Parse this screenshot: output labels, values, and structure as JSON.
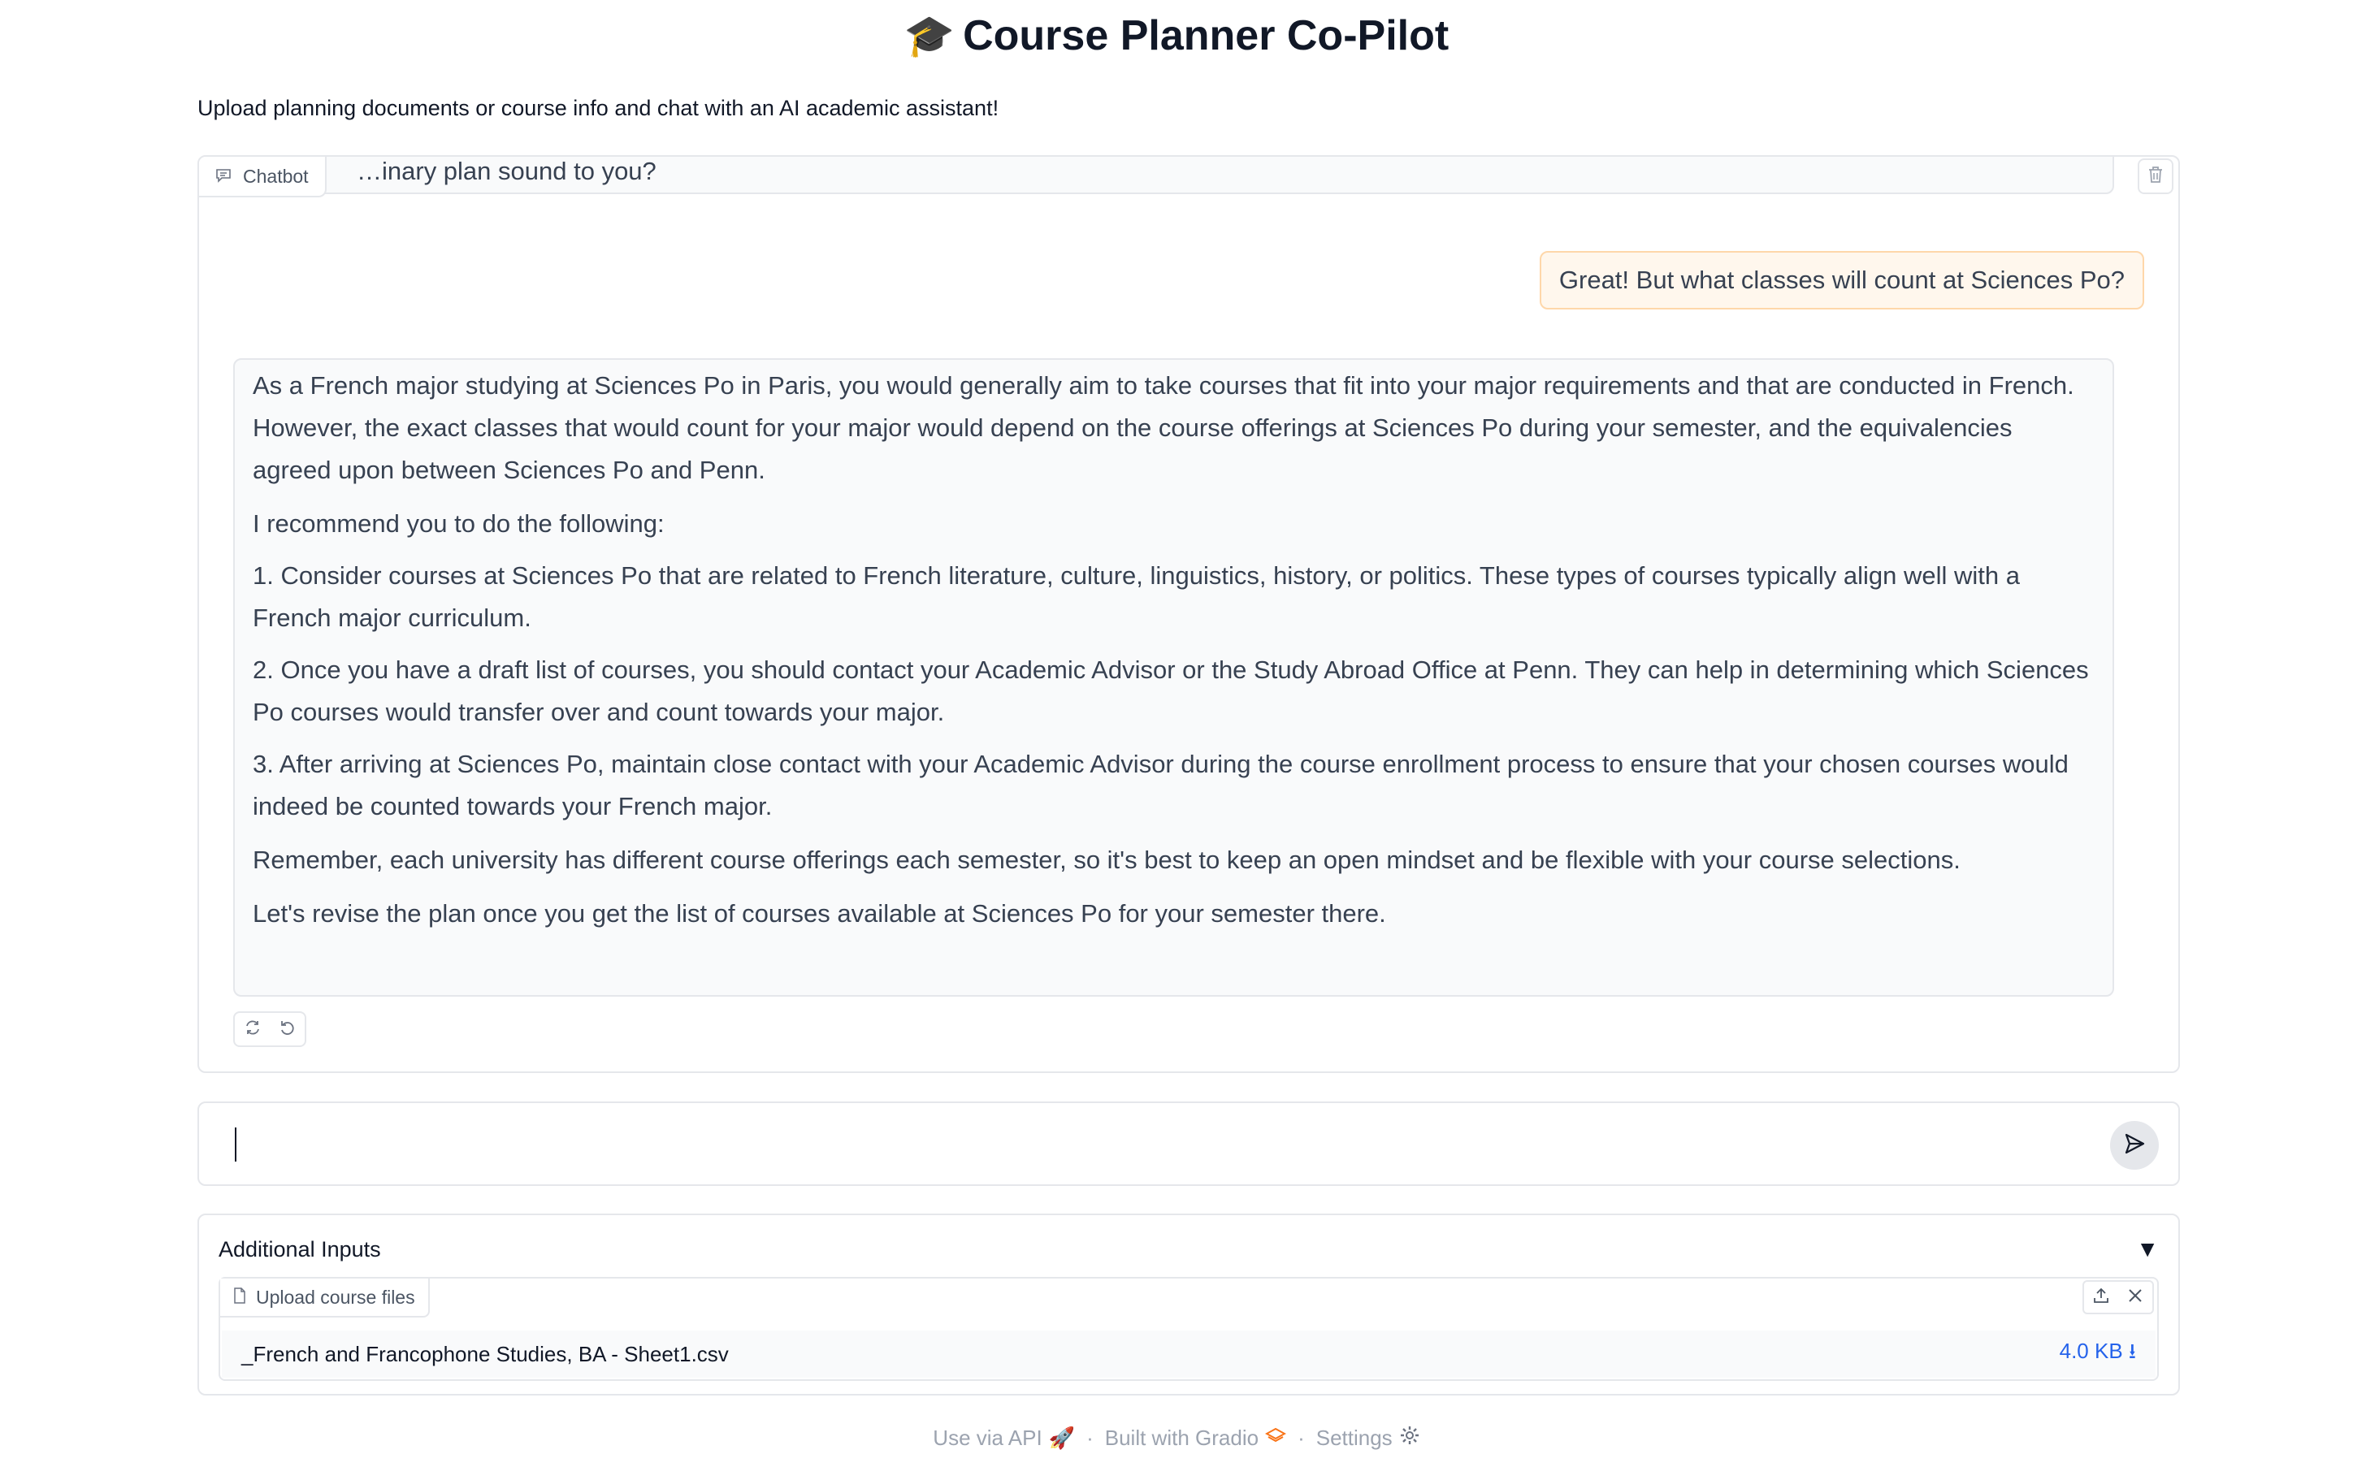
{
  "header": {
    "icon": "graduation-cap",
    "title": "Course Planner Co-Pilot",
    "subtitle": "Upload planning documents or course info and chat with an AI academic assistant!"
  },
  "chatbot": {
    "label": "Chatbot",
    "partial_message": "…inary plan sound to you?",
    "user_message": "Great! But what classes will count at Sciences Po?",
    "bot_message": {
      "p1": "As a French major studying at Sciences Po in Paris, you would generally aim to take courses that fit into your major requirements and that are conducted in French. However, the exact classes that would count for your major would depend on the course offerings at Sciences Po during your semester, and the equivalencies agreed upon between Sciences Po and Penn.",
      "p2": "I recommend you to do the following:",
      "p3": "1. Consider courses at Sciences Po that are related to French literature, culture, linguistics, history, or politics. These types of courses typically align well with a French major curriculum.",
      "p4": "2. Once you have a draft list of courses, you should contact your Academic Advisor or the Study Abroad Office at Penn. They can help in determining which Sciences Po courses would transfer over and count towards your major.",
      "p5": "3. After arriving at Sciences Po, maintain close contact with your Academic Advisor during the course enrollment process to ensure that your chosen courses would indeed be counted towards your French major.",
      "p6": "Remember, each university has different course offerings each semester, so it's best to keep an open mindset and be flexible with your course selections.",
      "p7": "Let's revise the plan once you get the list of courses available at Sciences Po for your semester there."
    }
  },
  "input": {
    "value": "",
    "placeholder": ""
  },
  "additional_inputs": {
    "label": "Additional Inputs",
    "toggle": "▼",
    "upload_label": "Upload course files",
    "file_name": "_French and Francophone Studies, BA - Sheet1.csv",
    "file_size": "4.0 KB ⭳"
  },
  "footer": {
    "api": "Use via API",
    "built": "Built with Gradio",
    "settings": "Settings",
    "sep": "·"
  },
  "colors": {
    "user_bubble_bg": "#fff7ed",
    "user_bubble_border": "#fed7aa",
    "link": "#2563eb",
    "gradio_orange": "#f97316"
  }
}
